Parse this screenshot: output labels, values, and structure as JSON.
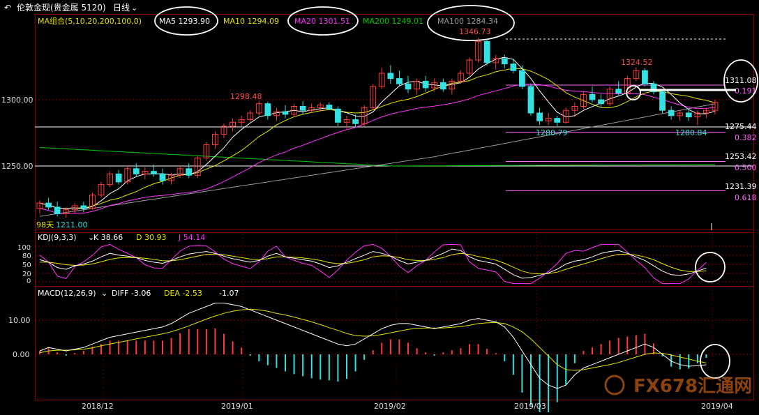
{
  "header": {
    "title": "伦敦金现(贵金属 5120)",
    "period": "日线",
    "ma_group": "MA组合(5,10,20,200,100,0)",
    "ma5": "MA5 1293.90",
    "ma10": "MA10 1294.09",
    "ma20": "MA20 1301.51",
    "ma200": "MA200 1249.01",
    "ma100": "MA100 1284.34"
  },
  "colors": {
    "background": "#000000",
    "up": "#ff3b3b",
    "down": "#35e0e0",
    "ma5": "#ffffff",
    "ma10": "#e6e600",
    "ma20": "#ff33ff",
    "ma200": "#00cc00",
    "ma100": "#9a9a9a",
    "fib": "#ff66ff",
    "grid": "#8b0000"
  },
  "price_panel": {
    "y_ticks": [
      "1300.00",
      "1250.00"
    ],
    "annotations": {
      "high": "1346.73",
      "peak2": "1324.52",
      "local": "1298.48",
      "low1": "1280.79",
      "low2": "1280.84",
      "start_low": "1211.00",
      "days": "98天"
    },
    "levels": [
      {
        "price": "1311.08",
        "ratio": "0.191"
      },
      {
        "price": "1275.44",
        "ratio": "0.382"
      },
      {
        "price": "1253.42",
        "ratio": "0.500"
      },
      {
        "price": "1231.39",
        "ratio": "0.618"
      }
    ]
  },
  "kdj": {
    "label": "KDJ(9,3,3)",
    "k": "K 38.66",
    "d": "D 30.93",
    "j": "J 54.14",
    "ticks": [
      "100",
      "80",
      "50",
      "20",
      "0"
    ]
  },
  "macd": {
    "label": "MACD(12,26,9)",
    "diff": "DIFF -3.06",
    "dea": "DEA -2.53",
    "macd_value": "-1.07",
    "ticks": [
      "10.00",
      "0.00"
    ]
  },
  "x_axis": {
    "labels": [
      "2018/12",
      "2019/01",
      "2019/02",
      "2019/03",
      "2019/04"
    ]
  },
  "watermark": "FX678汇通网",
  "chart_data": {
    "type": "candlestick",
    "title": "伦敦金现(贵金属 5120)",
    "period": "日线",
    "candles": [
      {
        "o": 1218,
        "h": 1224,
        "l": 1214,
        "c": 1222
      },
      {
        "o": 1222,
        "h": 1226,
        "l": 1217,
        "c": 1219
      },
      {
        "o": 1219,
        "h": 1223,
        "l": 1212,
        "c": 1214
      },
      {
        "o": 1214,
        "h": 1219,
        "l": 1211,
        "c": 1217
      },
      {
        "o": 1217,
        "h": 1222,
        "l": 1214,
        "c": 1220
      },
      {
        "o": 1220,
        "h": 1223,
        "l": 1215,
        "c": 1218
      },
      {
        "o": 1218,
        "h": 1230,
        "l": 1217,
        "c": 1228
      },
      {
        "o": 1228,
        "h": 1238,
        "l": 1226,
        "c": 1236
      },
      {
        "o": 1236,
        "h": 1246,
        "l": 1234,
        "c": 1244
      },
      {
        "o": 1244,
        "h": 1247,
        "l": 1236,
        "c": 1238
      },
      {
        "o": 1238,
        "h": 1250,
        "l": 1236,
        "c": 1248
      },
      {
        "o": 1248,
        "h": 1252,
        "l": 1242,
        "c": 1244
      },
      {
        "o": 1244,
        "h": 1249,
        "l": 1240,
        "c": 1246
      },
      {
        "o": 1246,
        "h": 1251,
        "l": 1242,
        "c": 1244
      },
      {
        "o": 1244,
        "h": 1248,
        "l": 1236,
        "c": 1239
      },
      {
        "o": 1239,
        "h": 1245,
        "l": 1236,
        "c": 1243
      },
      {
        "o": 1243,
        "h": 1250,
        "l": 1241,
        "c": 1248
      },
      {
        "o": 1248,
        "h": 1252,
        "l": 1241,
        "c": 1243
      },
      {
        "o": 1243,
        "h": 1258,
        "l": 1241,
        "c": 1256
      },
      {
        "o": 1256,
        "h": 1268,
        "l": 1254,
        "c": 1266
      },
      {
        "o": 1266,
        "h": 1276,
        "l": 1263,
        "c": 1274
      },
      {
        "o": 1274,
        "h": 1282,
        "l": 1271,
        "c": 1280
      },
      {
        "o": 1280,
        "h": 1286,
        "l": 1276,
        "c": 1283
      },
      {
        "o": 1283,
        "h": 1288,
        "l": 1280,
        "c": 1285
      },
      {
        "o": 1285,
        "h": 1292,
        "l": 1283,
        "c": 1290
      },
      {
        "o": 1290,
        "h": 1299,
        "l": 1288,
        "c": 1297
      },
      {
        "o": 1297,
        "h": 1298.48,
        "l": 1285,
        "c": 1288
      },
      {
        "o": 1288,
        "h": 1294,
        "l": 1284,
        "c": 1291
      },
      {
        "o": 1291,
        "h": 1296,
        "l": 1286,
        "c": 1289
      },
      {
        "o": 1289,
        "h": 1297,
        "l": 1287,
        "c": 1295
      },
      {
        "o": 1295,
        "h": 1299,
        "l": 1289,
        "c": 1292
      },
      {
        "o": 1292,
        "h": 1297,
        "l": 1290,
        "c": 1294
      },
      {
        "o": 1294,
        "h": 1298,
        "l": 1291,
        "c": 1296
      },
      {
        "o": 1296,
        "h": 1298,
        "l": 1292,
        "c": 1293
      },
      {
        "o": 1293,
        "h": 1295,
        "l": 1280,
        "c": 1283
      },
      {
        "o": 1283,
        "h": 1288,
        "l": 1278,
        "c": 1285
      },
      {
        "o": 1285,
        "h": 1289,
        "l": 1280,
        "c": 1282
      },
      {
        "o": 1282,
        "h": 1296,
        "l": 1280,
        "c": 1294
      },
      {
        "o": 1294,
        "h": 1312,
        "l": 1292,
        "c": 1310
      },
      {
        "o": 1310,
        "h": 1324,
        "l": 1308,
        "c": 1320
      },
      {
        "o": 1320,
        "h": 1326,
        "l": 1312,
        "c": 1316
      },
      {
        "o": 1316,
        "h": 1322,
        "l": 1310,
        "c": 1312
      },
      {
        "o": 1312,
        "h": 1318,
        "l": 1305,
        "c": 1308
      },
      {
        "o": 1308,
        "h": 1316,
        "l": 1304,
        "c": 1314
      },
      {
        "o": 1314,
        "h": 1318,
        "l": 1306,
        "c": 1309
      },
      {
        "o": 1309,
        "h": 1316,
        "l": 1306,
        "c": 1313
      },
      {
        "o": 1313,
        "h": 1316,
        "l": 1306,
        "c": 1308
      },
      {
        "o": 1308,
        "h": 1316,
        "l": 1304,
        "c": 1314
      },
      {
        "o": 1314,
        "h": 1322,
        "l": 1312,
        "c": 1320
      },
      {
        "o": 1320,
        "h": 1332,
        "l": 1318,
        "c": 1330
      },
      {
        "o": 1330,
        "h": 1346.73,
        "l": 1328,
        "c": 1344
      },
      {
        "o": 1344,
        "h": 1346,
        "l": 1326,
        "c": 1328
      },
      {
        "o": 1328,
        "h": 1334,
        "l": 1323,
        "c": 1331
      },
      {
        "o": 1331,
        "h": 1334,
        "l": 1324,
        "c": 1327
      },
      {
        "o": 1327,
        "h": 1331,
        "l": 1320,
        "c": 1322
      },
      {
        "o": 1322,
        "h": 1326,
        "l": 1308,
        "c": 1310
      },
      {
        "o": 1310,
        "h": 1312,
        "l": 1288,
        "c": 1290
      },
      {
        "o": 1290,
        "h": 1294,
        "l": 1281,
        "c": 1284
      },
      {
        "o": 1284,
        "h": 1290,
        "l": 1280.79,
        "c": 1286
      },
      {
        "o": 1286,
        "h": 1288,
        "l": 1280,
        "c": 1283
      },
      {
        "o": 1283,
        "h": 1294,
        "l": 1282,
        "c": 1292
      },
      {
        "o": 1292,
        "h": 1298,
        "l": 1287,
        "c": 1295
      },
      {
        "o": 1295,
        "h": 1306,
        "l": 1293,
        "c": 1304
      },
      {
        "o": 1304,
        "h": 1310,
        "l": 1298,
        "c": 1300
      },
      {
        "o": 1300,
        "h": 1304,
        "l": 1294,
        "c": 1297
      },
      {
        "o": 1297,
        "h": 1310,
        "l": 1295,
        "c": 1308
      },
      {
        "o": 1308,
        "h": 1314,
        "l": 1303,
        "c": 1305
      },
      {
        "o": 1305,
        "h": 1318,
        "l": 1303,
        "c": 1316
      },
      {
        "o": 1316,
        "h": 1324.52,
        "l": 1314,
        "c": 1322
      },
      {
        "o": 1322,
        "h": 1324,
        "l": 1310,
        "c": 1312
      },
      {
        "o": 1312,
        "h": 1314,
        "l": 1304,
        "c": 1306
      },
      {
        "o": 1306,
        "h": 1308,
        "l": 1290,
        "c": 1292
      },
      {
        "o": 1292,
        "h": 1295,
        "l": 1285,
        "c": 1288
      },
      {
        "o": 1288,
        "h": 1292,
        "l": 1284,
        "c": 1290
      },
      {
        "o": 1290,
        "h": 1293,
        "l": 1284,
        "c": 1287
      },
      {
        "o": 1287,
        "h": 1292,
        "l": 1280.84,
        "c": 1290
      },
      {
        "o": 1290,
        "h": 1294,
        "l": 1286,
        "c": 1292
      },
      {
        "o": 1292,
        "h": 1300,
        "l": 1289,
        "c": 1298
      }
    ],
    "kdj": {
      "k": [
        62,
        55,
        40,
        35,
        45,
        50,
        58,
        70,
        80,
        75,
        72,
        68,
        60,
        55,
        52,
        60,
        70,
        78,
        82,
        85,
        80,
        72,
        65,
        60,
        55,
        60,
        72,
        80,
        70,
        66,
        62,
        58,
        50,
        40,
        45,
        55,
        65,
        75,
        85,
        80,
        72,
        60,
        50,
        55,
        60,
        70,
        80,
        92,
        88,
        70,
        60,
        55,
        50,
        35,
        20,
        10,
        12,
        18,
        25,
        35,
        50,
        58,
        62,
        70,
        80,
        85,
        88,
        80,
        70,
        60,
        45,
        30,
        20,
        18,
        22,
        30,
        38.66
      ],
      "d": [
        55,
        55,
        52,
        48,
        46,
        47,
        50,
        56,
        63,
        67,
        68,
        68,
        66,
        63,
        59,
        59,
        62,
        67,
        72,
        77,
        78,
        76,
        72,
        68,
        64,
        62,
        65,
        70,
        70,
        69,
        67,
        64,
        60,
        54,
        51,
        52,
        56,
        62,
        70,
        73,
        72,
        68,
        62,
        60,
        60,
        63,
        68,
        76,
        80,
        77,
        71,
        66,
        61,
        52,
        41,
        30,
        24,
        22,
        23,
        27,
        35,
        43,
        50,
        57,
        65,
        72,
        77,
        78,
        75,
        70,
        62,
        51,
        41,
        33,
        29,
        29,
        30.93
      ],
      "j": [
        75,
        55,
        16,
        9,
        43,
        56,
        74,
        98,
        105,
        91,
        80,
        68,
        48,
        39,
        38,
        62,
        86,
        100,
        102,
        101,
        84,
        64,
        51,
        44,
        37,
        56,
        86,
        100,
        70,
        60,
        52,
        46,
        30,
        12,
        33,
        61,
        83,
        101,
        105,
        94,
        72,
        44,
        26,
        45,
        60,
        84,
        104,
        110,
        104,
        56,
        38,
        33,
        28,
        1,
        -22,
        -30,
        -12,
        10,
        29,
        51,
        80,
        88,
        86,
        96,
        110,
        111,
        110,
        84,
        60,
        40,
        11,
        -12,
        -22,
        -12,
        8,
        32,
        54.14
      ]
    },
    "macd": {
      "diff": [
        1,
        2,
        1.5,
        1,
        1.5,
        2,
        3,
        4,
        5,
        5.5,
        6,
        6.5,
        7,
        7.5,
        8,
        9,
        10.5,
        12,
        13,
        14,
        15,
        15,
        14.5,
        14,
        13,
        12,
        11,
        10,
        9,
        8,
        7,
        6,
        5,
        4,
        3,
        2.5,
        3,
        4.5,
        6,
        7.5,
        8.5,
        9,
        9,
        8.5,
        8,
        7.5,
        8,
        8.5,
        9,
        10,
        10.5,
        10,
        9.5,
        8,
        5,
        1,
        -3,
        -7,
        -9,
        -10,
        -9,
        -6,
        -4,
        -3,
        -2,
        -1,
        0,
        1,
        2,
        3,
        2,
        0,
        -2,
        -3,
        -3.5,
        -3.3,
        -3.06
      ],
      "dea": [
        0.5,
        1,
        1.2,
        1.2,
        1.3,
        1.5,
        1.9,
        2.5,
        3,
        3.5,
        4,
        4.5,
        5,
        5.5,
        6,
        6.6,
        7.4,
        8.3,
        9.3,
        10.3,
        11.2,
        12,
        12.6,
        13,
        13.2,
        13,
        12.6,
        12,
        11.5,
        10.9,
        10.2,
        9.5,
        8.7,
        7.8,
        7,
        6.1,
        5.5,
        5.3,
        5.4,
        5.8,
        6.3,
        6.8,
        7.3,
        7.6,
        7.7,
        7.7,
        7.7,
        7.9,
        8.1,
        8.5,
        9,
        9.2,
        9.3,
        9,
        8,
        6.6,
        4.5,
        2,
        -0.5,
        -3,
        -4.5,
        -4.7,
        -4.5,
        -4,
        -3.5,
        -3,
        -2.4,
        -1.6,
        -0.8,
        0,
        0.4,
        0.3,
        -0.2,
        -0.8,
        -1.4,
        -2,
        -2.53
      ]
    }
  }
}
